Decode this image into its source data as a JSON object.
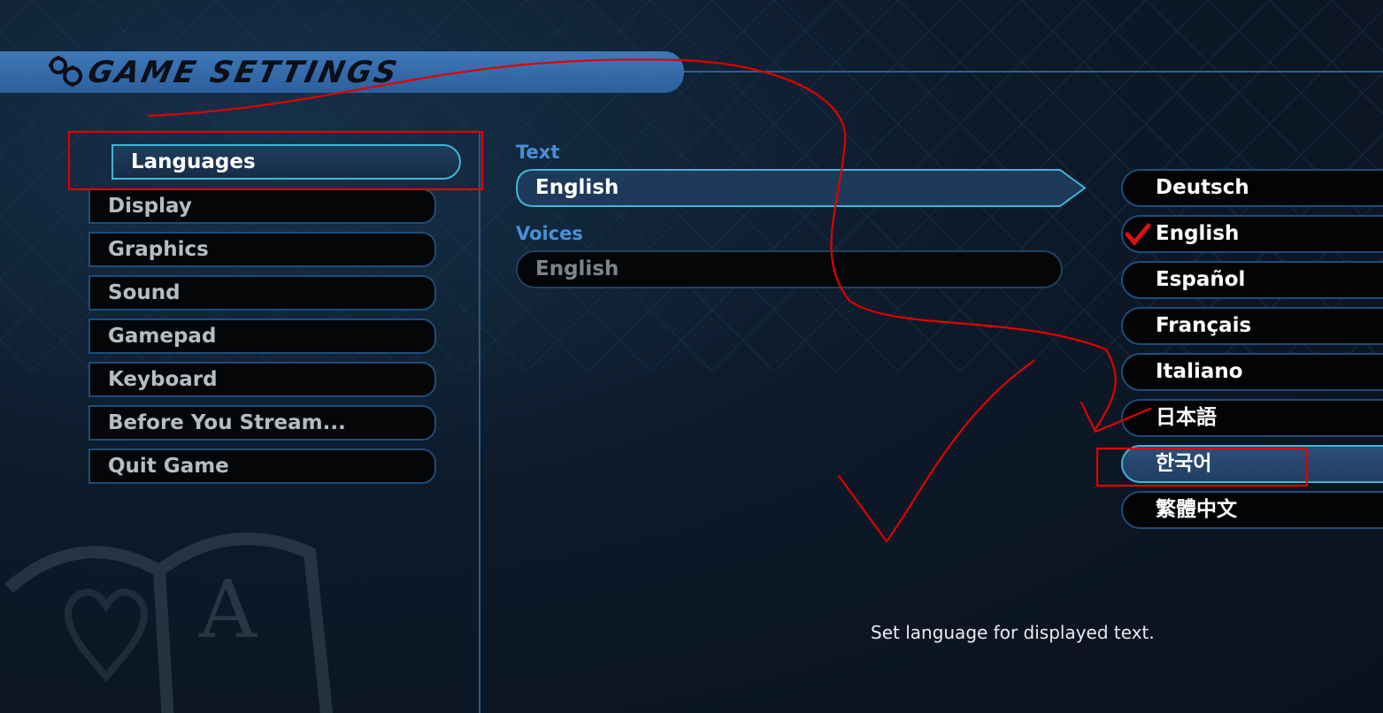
{
  "header": {
    "title": "GAME SETTINGS",
    "icon": "gear-icon"
  },
  "menu": {
    "items": [
      {
        "label": "Languages",
        "selected": true
      },
      {
        "label": "Display"
      },
      {
        "label": "Graphics"
      },
      {
        "label": "Sound"
      },
      {
        "label": "Gamepad"
      },
      {
        "label": "Keyboard"
      },
      {
        "label": "Before You Stream..."
      },
      {
        "label": "Quit Game"
      }
    ]
  },
  "settings": {
    "text_label": "Text",
    "text_value": "English",
    "voices_label": "Voices",
    "voices_value": "English"
  },
  "languages": {
    "items": [
      {
        "label": "Deutsch"
      },
      {
        "label": "English",
        "checked": true
      },
      {
        "label": "Español"
      },
      {
        "label": "Français"
      },
      {
        "label": "Italiano"
      },
      {
        "label": "日本語"
      },
      {
        "label": "한국어",
        "highlighted": true
      },
      {
        "label": "繁體中文"
      }
    ]
  },
  "hint": "Set language for displayed text.",
  "colors": {
    "accent": "#3fb7d8",
    "label_blue": "#4a90d9",
    "header_blue": "#3f78b8",
    "annotation_red": "#e00000"
  }
}
